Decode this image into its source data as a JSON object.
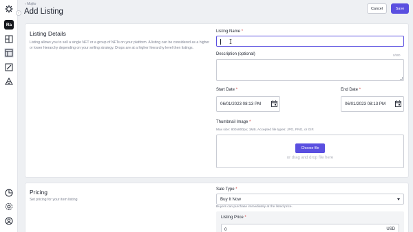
{
  "sidebar": {
    "avatar_text": "Ra",
    "top_icons": [
      "logo-gear-icon",
      "dashboard-icon",
      "listings-icon",
      "edit-icon",
      "drops-icon"
    ],
    "bottom_icons": [
      "analytics-icon",
      "settings-icon",
      "profile-icon"
    ]
  },
  "header": {
    "breadcrumb": "Mojito",
    "title": "Add Listing",
    "cancel_label": "Cancel",
    "save_label": "Save"
  },
  "details": {
    "title": "Listing Details",
    "description": "Listing allows you to sell a single NFT or a group of NFTs on your platform. A listing can be considered as a higher or lower hierarchy depending on your selling strategy. Drops are at a higher hierarchy level then listings.",
    "listing_name": {
      "label": "Listing Name",
      "required": "*",
      "value": ""
    },
    "desc_field": {
      "label": "Description (optional)",
      "counter": "0/800",
      "value": ""
    },
    "start_date": {
      "label": "Start Date",
      "required": "*",
      "value": "06/01/2023 08:13 PM"
    },
    "end_date": {
      "label": "End Date",
      "required": "*",
      "value": "06/01/2023 08:13 PM"
    },
    "thumbnail": {
      "label": "Thumbnail Image",
      "required": "*",
      "hint": "Max size: 800x800px; 1MB. Accepted file types: JPG, PNG, or GIF.",
      "button": "Choose file",
      "drop_hint": "or drag and drop file here"
    }
  },
  "pricing": {
    "title": "Pricing",
    "description": "Set pricing for your item listing",
    "sale_type": {
      "label": "Sale Type",
      "required": "*",
      "value": "Buy It Now",
      "hint": "Buyers can purchase immediately at the listed price."
    },
    "listing_price": {
      "label": "Listing Price",
      "required": "*",
      "value": "0",
      "unit": "USD"
    }
  },
  "colors": {
    "accent": "#5a4fe0",
    "required": "#d43a3a",
    "muted": "#7b8090"
  }
}
